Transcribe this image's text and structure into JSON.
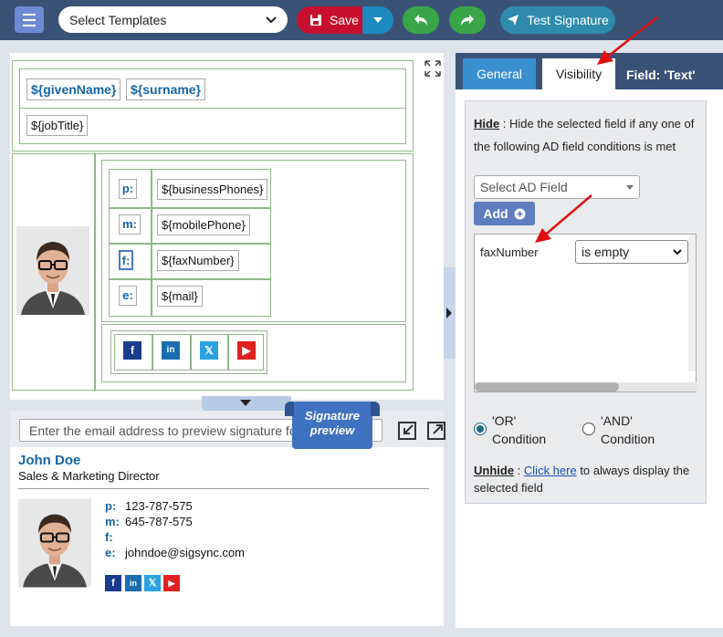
{
  "toolbar": {
    "template_select": "Select Templates",
    "save_label": "Save",
    "test_label": "Test Signature"
  },
  "editor": {
    "given_name": "${givenName}",
    "surname": "${surname}",
    "job_title": "${jobTitle}",
    "contact_rows": [
      {
        "label": "p:",
        "value": "${businessPhones}"
      },
      {
        "label": "m:",
        "value": "${mobilePhone}"
      },
      {
        "label": "f:",
        "value": "${faxNumber}"
      },
      {
        "label": "e:",
        "value": "${mail}"
      }
    ],
    "social_icons": [
      "facebook-icon",
      "linkedin-icon",
      "x-icon",
      "youtube-icon"
    ]
  },
  "preview": {
    "email_placeholder": "Enter the email address to preview signature for",
    "ribbon": "Signature preview",
    "name": "John Doe",
    "title": "Sales & Marketing Director",
    "rows": [
      {
        "label": "p:",
        "value": "123-787-575"
      },
      {
        "label": "m:",
        "value": "645-787-575"
      },
      {
        "label": "f:",
        "value": ""
      },
      {
        "label": "e:",
        "value": "johndoe@sigsync.com"
      }
    ]
  },
  "panel": {
    "tab_general": "General",
    "tab_visibility": "Visibility",
    "field_prefix": "Field: ",
    "field_name": "'Text'",
    "hide_label": "Hide",
    "hide_desc": " : Hide the selected field if any one of the following AD field conditions is met",
    "ad_select": "Select AD Field",
    "add_label": "Add",
    "condition_field": "faxNumber",
    "condition_operator": "is empty",
    "or_label": "'OR' Condition",
    "and_label": "'AND' Condition",
    "unhide_label": "Unhide",
    "unhide_pre": " : ",
    "unhide_link": "Click here",
    "unhide_post": " to always display the selected field"
  },
  "colors": {
    "toolbar_bg": "#3b5277",
    "save_red": "#c8102e",
    "accent_blue": "#1565a8",
    "green": "#3aa64a",
    "teal": "#2e8bab"
  }
}
